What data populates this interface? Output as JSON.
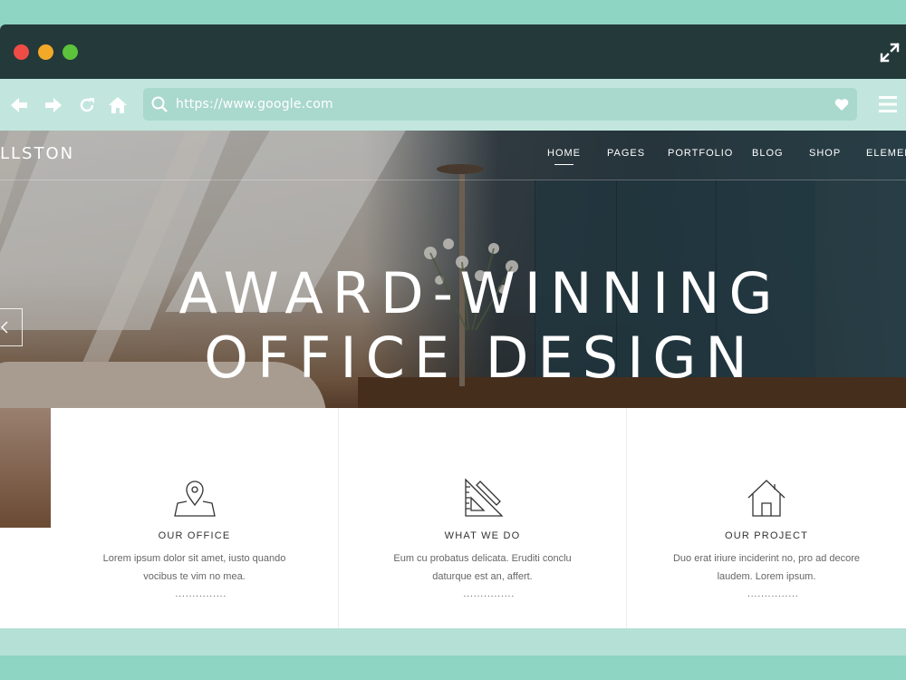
{
  "browser": {
    "url": "https://www.google.com",
    "controls": [
      "close",
      "minimize",
      "maximize"
    ],
    "colors": {
      "titlebar": "#24393a",
      "navbar": "#c2e6dd",
      "urlbar": "#a9d8cc",
      "background": "#8ed5c3"
    }
  },
  "nav_icons": [
    "back-arrow-icon",
    "forward-arrow-icon",
    "reload-icon",
    "home-icon",
    "heart-icon",
    "hamburger-menu-icon",
    "expand-icon"
  ],
  "site": {
    "brand": "LLSTON",
    "menu": [
      "HOME",
      "PAGES",
      "PORTFOLIO",
      "BLOG",
      "SHOP",
      "ELEMENTS"
    ],
    "active_menu": "HOME"
  },
  "hero": {
    "line1": "AWARD-WINNING",
    "line2": "OFFICE DESIGN"
  },
  "cards": [
    {
      "icon": "location-map-icon",
      "title": "OUR OFFICE",
      "desc1": "Lorem ipsum dolor sit amet, iusto quando",
      "desc2": "vocibus te vim no mea.",
      "dots": "..............."
    },
    {
      "icon": "ruler-triangle-icon",
      "title": "WHAT WE DO",
      "desc1": "Eum cu probatus delicata. Eruditi conclu",
      "desc2": "daturque est an, affert.",
      "dots": "..............."
    },
    {
      "icon": "house-icon",
      "title": "OUR PROJECT",
      "desc1": "Duo erat iriure inciderint no, pro ad decore",
      "desc2": "laudem. Lorem ipsum.",
      "dots": "..............."
    }
  ]
}
